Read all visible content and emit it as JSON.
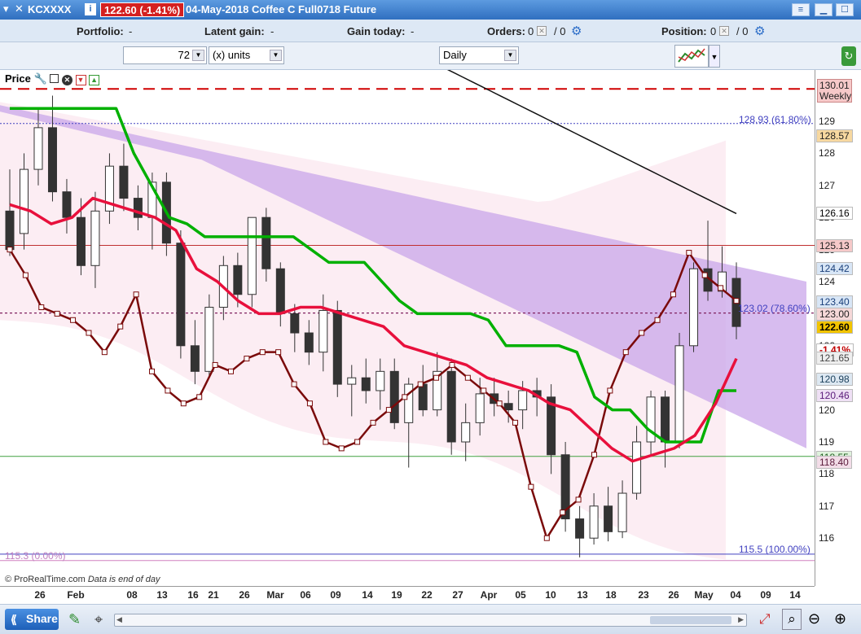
{
  "titlebar": {
    "symbol": "KCXXXX",
    "price_badge": "122.60 (-1.41%)",
    "description": "04-May-2018 Coffee C Full0718 Future"
  },
  "stats": {
    "portfolio_label": "Portfolio:",
    "portfolio_value": "-",
    "latent_label": "Latent gain:",
    "latent_value": "-",
    "today_label": "Gain today:",
    "today_value": "-",
    "orders_label": "Orders:",
    "orders_value": "0",
    "orders_sep": "/ 0",
    "position_label": "Position:",
    "position_value": "0",
    "position_sep": "/ 0"
  },
  "toolbar": {
    "units_value": "72",
    "units_label": "(x) units",
    "period_value": "Daily"
  },
  "panel": {
    "label": "Price"
  },
  "annotations": {
    "fib_618": "128.93 (61.80%)",
    "fib_786": "123.02 (78.60%)",
    "fib_100": "115.5 (100.00%)",
    "fib_0": "115.3 (0.00%)",
    "copyright": "© ProRealTime.com",
    "eod": "Data is end of day"
  },
  "price_axis": {
    "weekly_value": "130.01",
    "weekly_label": "Weekly",
    "ticks": [
      "129",
      "128",
      "127",
      "126",
      "125",
      "124",
      "123",
      "122",
      "121",
      "120",
      "119",
      "118",
      "117",
      "116"
    ],
    "markers": [
      {
        "text": "128.57",
        "bg": "#f7d8a0",
        "fg": "#222"
      },
      {
        "text": "126.16",
        "bg": "#ffffff",
        "fg": "#000"
      },
      {
        "text": "125.13",
        "bg": "#f6c9c9",
        "fg": "#222"
      },
      {
        "text": "124.42",
        "bg": "#d8e6f6",
        "fg": "#1a3f7a"
      },
      {
        "text": "123.40",
        "bg": "#d8e6f6",
        "fg": "#1a3f7a"
      },
      {
        "text": "123.00",
        "bg": "#f6d8d8",
        "fg": "#222"
      },
      {
        "text": "122.60",
        "bg": "#f2c400",
        "fg": "#000"
      },
      {
        "text": "-1.41%",
        "bg": "#ffffff",
        "fg": "#c00000"
      },
      {
        "text": "121.65",
        "bg": "#eeeeee",
        "fg": "#444"
      },
      {
        "text": "120.98",
        "bg": "#dde8f2",
        "fg": "#1a3f5a"
      },
      {
        "text": "120.46",
        "bg": "#efe0f5",
        "fg": "#5a1a7a"
      },
      {
        "text": "118.55",
        "bg": "#dff2dc",
        "fg": "#1a5a1a"
      },
      {
        "text": "118.40",
        "bg": "#f3dde8",
        "fg": "#5a1a3a"
      }
    ]
  },
  "date_axis": {
    "labels": [
      "26",
      "Feb",
      "08",
      "13",
      "16",
      "21",
      "26",
      "Mar",
      "06",
      "09",
      "14",
      "19",
      "22",
      "27",
      "Apr",
      "05",
      "10",
      "13",
      "18",
      "23",
      "26",
      "May",
      "04",
      "09",
      "14"
    ]
  },
  "bottombar": {
    "share_label": "Share"
  },
  "chart_data": {
    "type": "candlestick",
    "ylim": [
      114.8,
      131.2
    ],
    "x": [
      "26",
      "Feb",
      "08",
      "13",
      "16",
      "21",
      "26",
      "Mar",
      "06",
      "09",
      "14",
      "19",
      "22",
      "27",
      "Apr",
      "05",
      "10",
      "13",
      "18",
      "23",
      "26",
      "May",
      "04",
      "09",
      "14"
    ],
    "candles": [
      {
        "o": 126.2,
        "h": 127.5,
        "l": 124.8,
        "c": 125.0
      },
      {
        "o": 125.5,
        "h": 128.0,
        "l": 125.0,
        "c": 127.5
      },
      {
        "o": 127.5,
        "h": 129.4,
        "l": 127.0,
        "c": 128.8
      },
      {
        "o": 128.8,
        "h": 129.8,
        "l": 126.5,
        "c": 126.8
      },
      {
        "o": 126.8,
        "h": 127.2,
        "l": 125.5,
        "c": 126.0
      },
      {
        "o": 126.0,
        "h": 126.6,
        "l": 124.2,
        "c": 124.5
      },
      {
        "o": 124.5,
        "h": 126.8,
        "l": 123.8,
        "c": 126.2
      },
      {
        "o": 126.2,
        "h": 128.0,
        "l": 125.8,
        "c": 127.6
      },
      {
        "o": 127.6,
        "h": 128.3,
        "l": 126.2,
        "c": 126.6
      },
      {
        "o": 126.6,
        "h": 127.0,
        "l": 125.6,
        "c": 126.0
      },
      {
        "o": 126.0,
        "h": 127.4,
        "l": 125.0,
        "c": 127.1
      },
      {
        "o": 127.1,
        "h": 127.4,
        "l": 124.8,
        "c": 125.2
      },
      {
        "o": 125.2,
        "h": 125.6,
        "l": 121.6,
        "c": 122.0
      },
      {
        "o": 122.0,
        "h": 122.8,
        "l": 120.8,
        "c": 121.2
      },
      {
        "o": 121.2,
        "h": 123.6,
        "l": 121.0,
        "c": 123.2
      },
      {
        "o": 123.2,
        "h": 124.8,
        "l": 122.8,
        "c": 124.5
      },
      {
        "o": 124.5,
        "h": 124.9,
        "l": 123.2,
        "c": 123.6
      },
      {
        "o": 123.6,
        "h": 125.6,
        "l": 123.2,
        "c": 126.0
      },
      {
        "o": 126.0,
        "h": 126.3,
        "l": 124.0,
        "c": 124.4
      },
      {
        "o": 124.4,
        "h": 124.6,
        "l": 122.6,
        "c": 123.0
      },
      {
        "o": 123.0,
        "h": 123.3,
        "l": 121.8,
        "c": 122.4
      },
      {
        "o": 122.4,
        "h": 122.8,
        "l": 121.4,
        "c": 121.8
      },
      {
        "o": 121.8,
        "h": 123.6,
        "l": 121.2,
        "c": 123.1
      },
      {
        "o": 123.1,
        "h": 123.4,
        "l": 120.4,
        "c": 120.8
      },
      {
        "o": 120.8,
        "h": 121.4,
        "l": 119.8,
        "c": 121.0
      },
      {
        "o": 121.0,
        "h": 121.6,
        "l": 120.2,
        "c": 120.6
      },
      {
        "o": 120.6,
        "h": 121.6,
        "l": 120.0,
        "c": 121.2
      },
      {
        "o": 121.2,
        "h": 121.6,
        "l": 119.4,
        "c": 119.6
      },
      {
        "o": 119.6,
        "h": 121.0,
        "l": 118.2,
        "c": 120.8
      },
      {
        "o": 120.8,
        "h": 121.4,
        "l": 119.8,
        "c": 120.0
      },
      {
        "o": 120.0,
        "h": 121.8,
        "l": 119.8,
        "c": 121.2
      },
      {
        "o": 121.2,
        "h": 121.6,
        "l": 118.6,
        "c": 119.0
      },
      {
        "o": 119.0,
        "h": 120.2,
        "l": 118.4,
        "c": 119.6
      },
      {
        "o": 119.6,
        "h": 121.0,
        "l": 119.2,
        "c": 120.5
      },
      {
        "o": 120.5,
        "h": 121.0,
        "l": 119.8,
        "c": 120.2
      },
      {
        "o": 120.2,
        "h": 120.6,
        "l": 119.6,
        "c": 120.0
      },
      {
        "o": 120.0,
        "h": 120.9,
        "l": 119.4,
        "c": 120.6
      },
      {
        "o": 120.6,
        "h": 121.0,
        "l": 119.8,
        "c": 120.4
      },
      {
        "o": 120.4,
        "h": 120.8,
        "l": 118.0,
        "c": 118.6
      },
      {
        "o": 118.6,
        "h": 119.0,
        "l": 116.2,
        "c": 116.6
      },
      {
        "o": 116.6,
        "h": 117.0,
        "l": 115.4,
        "c": 116.0
      },
      {
        "o": 116.0,
        "h": 117.4,
        "l": 115.8,
        "c": 117.0
      },
      {
        "o": 117.0,
        "h": 117.6,
        "l": 115.9,
        "c": 116.2
      },
      {
        "o": 116.2,
        "h": 117.8,
        "l": 116.0,
        "c": 117.4
      },
      {
        "o": 117.4,
        "h": 119.5,
        "l": 117.2,
        "c": 119.0
      },
      {
        "o": 119.0,
        "h": 120.6,
        "l": 118.6,
        "c": 120.4
      },
      {
        "o": 120.4,
        "h": 120.6,
        "l": 118.2,
        "c": 119.0
      },
      {
        "o": 119.0,
        "h": 122.4,
        "l": 118.8,
        "c": 122.0
      },
      {
        "o": 122.0,
        "h": 124.6,
        "l": 121.8,
        "c": 124.4
      },
      {
        "o": 124.4,
        "h": 125.9,
        "l": 123.4,
        "c": 123.7
      },
      {
        "o": 123.7,
        "h": 125.1,
        "l": 123.5,
        "c": 124.3
      },
      {
        "o": 124.1,
        "h": 124.6,
        "l": 122.2,
        "c": 122.6
      }
    ],
    "series": [
      {
        "name": "",
        "color": "#7a0a0a",
        "values": [
          125,
          124.2,
          123.2,
          123,
          122.8,
          122.4,
          121.8,
          122.6,
          123.6,
          121.2,
          120.6,
          120.2,
          120.4,
          121.4,
          121.2,
          121.6,
          121.8,
          121.8,
          120.8,
          120.2,
          119,
          118.8,
          119.0,
          119.6,
          120,
          120.4,
          120.8,
          121,
          121.4,
          121.0,
          120.6,
          120.2,
          119.6,
          117.6,
          116.0,
          116.8,
          117.2,
          118.6,
          120.6,
          121.8,
          122.4,
          122.8,
          123.6,
          124.9,
          124.2,
          123.8,
          123.4
        ]
      },
      {
        "name": "",
        "color": "#00b000",
        "values": [
          129.4,
          129.4,
          129.4,
          129.4,
          129.4,
          129.4,
          129.4,
          128.0,
          127.0,
          126.0,
          125.8,
          125.4,
          125.4,
          125.4,
          125.4,
          125.4,
          125.4,
          125.0,
          124.6,
          124.6,
          124.6,
          124.0,
          123.4,
          123.0,
          123.0,
          123.0,
          123.0,
          122.8,
          122.0,
          122.0,
          122.0,
          122.0,
          121.8,
          120.4,
          120.0,
          120.0,
          119.4,
          119.0,
          119.0,
          119.0,
          120.6,
          120.6
        ]
      },
      {
        "name": "",
        "color": "#e8103c",
        "values": [
          126.4,
          126.2,
          125.8,
          126.0,
          126.6,
          126.4,
          126.2,
          126.0,
          125.6,
          124.4,
          124.0,
          123.4,
          123.0,
          123.0,
          123.2,
          123.2,
          123.0,
          122.8,
          122.6,
          122.0,
          121.8,
          121.6,
          121.4,
          121.0,
          120.8,
          120.6,
          120.2,
          120.0,
          119.4,
          118.8,
          118.4,
          118.6,
          118.8,
          119.2,
          120.2,
          121.6
        ]
      }
    ]
  }
}
